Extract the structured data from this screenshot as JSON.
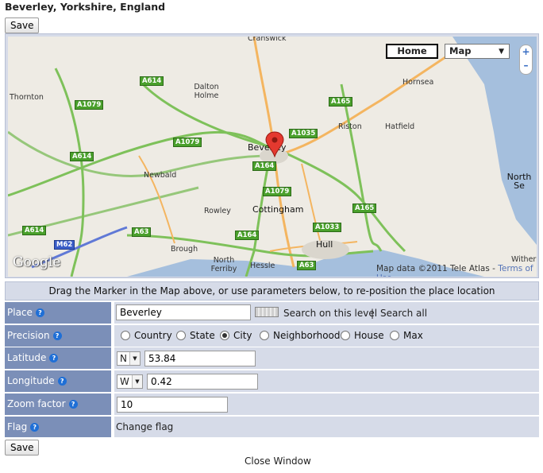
{
  "page": {
    "title": "Beverley, Yorkshire, England"
  },
  "toolbar": {
    "save_label": "Save"
  },
  "map": {
    "home_label": "Home",
    "type_selected": "Map",
    "zoom_in": "+",
    "zoom_out": "–",
    "logo": "Google",
    "attribution": "Map data ©2011 Tele Atlas - ",
    "terms_link": "Terms of Use",
    "places": [
      "Cranswick",
      "Dalton Holme",
      "Hornsea",
      "Thornton",
      "Riston",
      "Hatfield",
      "Beverley",
      "North Se",
      "Newbald",
      "Rowley",
      "Cottingham",
      "Brough",
      "North Ferriby",
      "Hessle",
      "Hull",
      "Withern"
    ],
    "roads": [
      "A614",
      "A1079",
      "A165",
      "A1035",
      "A1079",
      "A614",
      "A164",
      "A1079",
      "A165",
      "A614",
      "A63",
      "A164",
      "A1033",
      "A63",
      "M62"
    ]
  },
  "notice": "Drag the Marker in the Map above, or use parameters below, to re-position the place location",
  "help_icon": "?",
  "form": {
    "place": {
      "label": "Place",
      "value": "Beverley",
      "search_level": "Search on this level",
      "separator": "|",
      "search_all": "Search all"
    },
    "precision": {
      "label": "Precision",
      "options": [
        "Country",
        "State",
        "City",
        "Neighborhood",
        "House",
        "Max"
      ],
      "selected": "City"
    },
    "latitude": {
      "label": "Latitude",
      "hemisphere": "N",
      "value": "53.84"
    },
    "longitude": {
      "label": "Longitude",
      "hemisphere": "W",
      "value": "0.42"
    },
    "zoom": {
      "label": "Zoom factor",
      "value": "10"
    },
    "flag": {
      "label": "Flag",
      "link": "Change flag"
    }
  },
  "footer": {
    "close_window": "Close Window"
  }
}
